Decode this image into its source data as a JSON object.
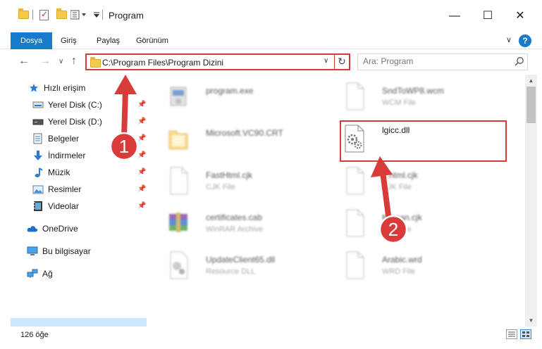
{
  "window": {
    "title": "Program"
  },
  "ribbon": {
    "tabs": [
      "Dosya",
      "Giriş",
      "Paylaş",
      "Görünüm"
    ]
  },
  "address": {
    "path": "C:\\Program Files\\Program Dizini"
  },
  "search": {
    "placeholder": "Ara: Program"
  },
  "sidebar": {
    "quick_access": "Hızlı erişim",
    "items": [
      {
        "label": "Yerel Disk (C:)",
        "icon": "drive-icon",
        "pinned": true
      },
      {
        "label": "Yerel Disk (D:)",
        "icon": "drive-icon",
        "pinned": true
      },
      {
        "label": "Belgeler",
        "icon": "documents-icon",
        "pinned": true
      },
      {
        "label": "İndirmeler",
        "icon": "download-icon",
        "pinned": true
      },
      {
        "label": "Müzik",
        "icon": "music-icon",
        "pinned": true
      },
      {
        "label": "Resimler",
        "icon": "pictures-icon",
        "pinned": true
      },
      {
        "label": "Videolar",
        "icon": "video-icon",
        "pinned": true
      }
    ],
    "onedrive": "OneDrive",
    "this_pc": "Bu bilgisayar",
    "network": "Ağ"
  },
  "files": [
    {
      "name": "program.exe",
      "type": "",
      "icon": "exe-icon"
    },
    {
      "name": "SndToWP8.wcm",
      "type": "WCM File",
      "icon": "file-icon"
    },
    {
      "name": "Microsoft.VC90.CRT",
      "type": "",
      "icon": "folder-icon"
    },
    {
      "name": "lgicc.dll",
      "type": "",
      "icon": "dll-gear-icon"
    },
    {
      "name": "FastHtml.cjk",
      "type": "CJK File",
      "icon": "file-icon"
    },
    {
      "name": "...html.cjk",
      "type": "CJK File",
      "icon": "file-icon"
    },
    {
      "name": "certificates.cab",
      "type": "WinRAR Archive",
      "icon": "winrar-icon"
    },
    {
      "name": "Korean.cjk",
      "type": "CJK File",
      "icon": "file-icon"
    },
    {
      "name": "UpdateClient65.dll",
      "type": "Resource DLL",
      "icon": "dll-gear-icon"
    },
    {
      "name": "Arabic.wrd",
      "type": "WRD File",
      "icon": "file-icon"
    }
  ],
  "status": {
    "item_count": "126 öğe"
  },
  "annotations": [
    "1",
    "2"
  ],
  "colors": {
    "accent": "#1979ca",
    "highlight": "#d43b3b",
    "selection": "#cce8ff"
  }
}
